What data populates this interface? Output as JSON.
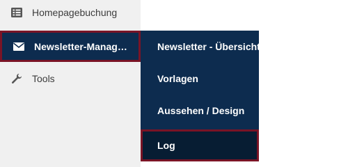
{
  "sidebar": {
    "items": [
      {
        "label": "Homepagebuchung",
        "icon": "list-icon"
      },
      {
        "label": "Newsletter-Managemen…",
        "icon": "envelope-icon"
      },
      {
        "label": "Tools",
        "icon": "wrench-icon"
      }
    ]
  },
  "submenu": {
    "items": [
      {
        "label": "Newsletter - Übersicht"
      },
      {
        "label": "Vorlagen"
      },
      {
        "label": "Aussehen / Design"
      },
      {
        "label": "Log"
      }
    ]
  },
  "colors": {
    "sidebar_bg": "#f0f0f0",
    "menu_bg": "#0d2c4f",
    "highlight_border": "#7a1426",
    "active_item_bg": "#071d33"
  }
}
